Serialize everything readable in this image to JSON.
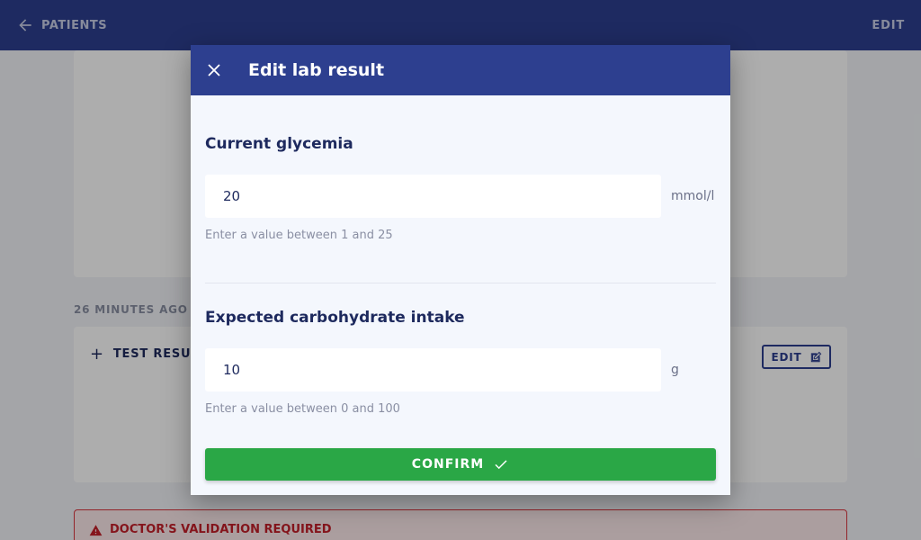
{
  "topbar": {
    "back_label": "PATIENTS",
    "edit_label": "EDIT"
  },
  "feed": {
    "timestamp": "26 MINUTES AGO",
    "test_results_label": "TEST RESULTS",
    "edit_label": "EDIT",
    "alert_label": "DOCTOR'S VALIDATION REQUIRED"
  },
  "modal": {
    "title": "Edit lab result",
    "fields": [
      {
        "label": "Current glycemia",
        "value": "20",
        "unit": "mmol/l",
        "hint": "Enter a value between 1 and 25"
      },
      {
        "label": "Expected carbohydrate intake",
        "value": "10",
        "unit": "g",
        "hint": "Enter a value between 0 and 100"
      }
    ],
    "confirm_label": "CONFIRM"
  },
  "colors": {
    "primary": "#2d3f8f",
    "confirm": "#2aa746",
    "alert": "#c4202a"
  },
  "icons": [
    "arrow-left-icon",
    "close-icon",
    "plus-icon",
    "edit-icon",
    "warning-icon",
    "check-icon"
  ]
}
